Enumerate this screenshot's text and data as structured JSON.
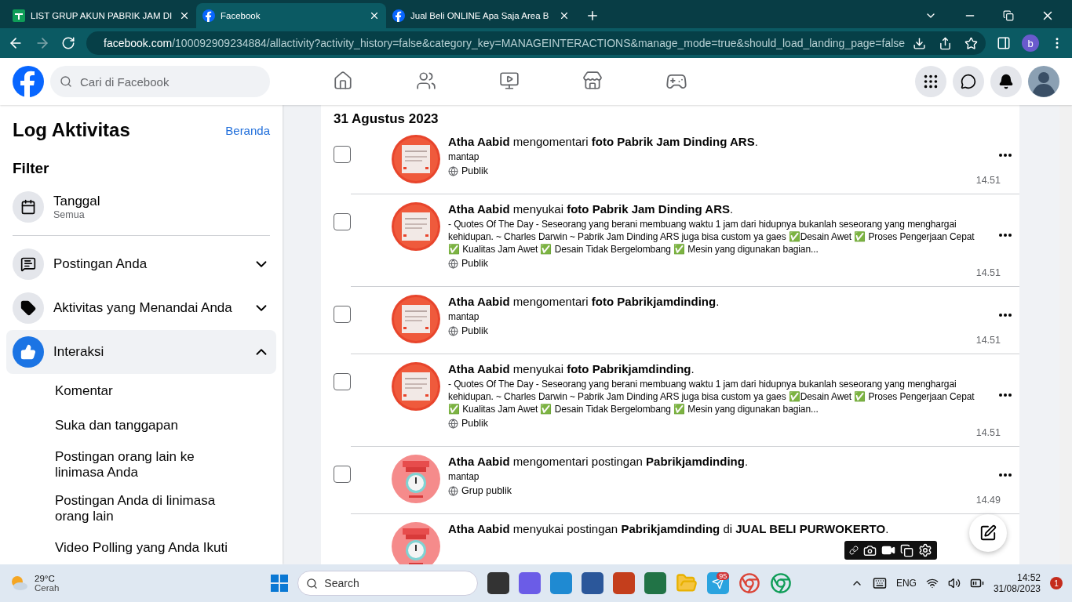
{
  "browser": {
    "tabs": [
      {
        "title": "LIST GRUP AKUN PABRIK JAM DI",
        "kind": "sheets",
        "selected": false
      },
      {
        "title": "Facebook",
        "kind": "facebook",
        "selected": true
      },
      {
        "title": "Jual Beli ONLINE Apa Saja Area B",
        "kind": "facebook",
        "selected": false
      }
    ],
    "url_host": "facebook.com",
    "url_path": "/100092909234884/allactivity?activity_history=false&category_key=MANAGEINTERACTIONS&manage_mode=true&should_load_landing_page=false",
    "profile_initial": "b"
  },
  "header": {
    "search_placeholder": "Cari di Facebook"
  },
  "sidebar": {
    "title": "Log Aktivitas",
    "home_link": "Beranda",
    "filter_heading": "Filter",
    "date_filter": {
      "label": "Tanggal",
      "value": "Semua"
    },
    "categories": [
      {
        "label": "Postingan Anda",
        "kind": "posts",
        "expanded": false,
        "selected": false
      },
      {
        "label": "Aktivitas yang Menandai Anda",
        "kind": "tags",
        "expanded": false,
        "selected": false
      },
      {
        "label": "Interaksi",
        "kind": "likes",
        "expanded": true,
        "selected": true,
        "children": [
          {
            "label": "Komentar"
          },
          {
            "label": "Suka dan tanggapan"
          },
          {
            "label": "Postingan orang lain ke linimasa Anda"
          },
          {
            "label": "Postingan Anda di linimasa orang lain"
          },
          {
            "label": "Video Polling yang Anda Ikuti"
          }
        ]
      }
    ]
  },
  "activity": {
    "date": "31 Agustus 2023",
    "items": [
      {
        "headline": "**Atha Aabid** mengomentari **foto Pabrik Jam Dinding ARS**.",
        "text": "mantap",
        "audience": "Publik",
        "time": "14.51",
        "checked": false,
        "kind": "quote"
      },
      {
        "headline": "**Atha Aabid** menyukai **foto Pabrik Jam Dinding ARS**.",
        "text": "- Quotes Of The Day - Seseorang yang berani membuang waktu 1 jam dari hidupnya bukanlah seseorang yang menghargai kehidupan. ~ Charles Darwin ~ Pabrik Jam Dinding ARS juga bisa custom ya gaes ✅Desain Awet ✅ Proses Pengerjaan Cepat ✅ Kualitas Jam Awet ✅ Desain Tidak Bergelombang ✅ Mesin yang digunakan bagian...",
        "audience": "Publik",
        "time": "14.51",
        "checked": false,
        "kind": "quote"
      },
      {
        "headline": "**Atha Aabid** mengomentari **foto Pabrikjamdinding**.",
        "text": "mantap",
        "audience": "Publik",
        "time": "14.51",
        "checked": false,
        "kind": "quote"
      },
      {
        "headline": "**Atha Aabid** menyukai **foto Pabrikjamdinding**.",
        "text": "- Quotes Of The Day - Seseorang yang berani membuang waktu 1 jam dari hidupnya bukanlah seseorang yang menghargai kehidupan. ~ Charles Darwin ~ Pabrik Jam Dinding ARS juga bisa custom ya gaes ✅Desain Awet ✅ Proses Pengerjaan Cepat ✅ Kualitas Jam Awet ✅ Desain Tidak Bergelombang ✅ Mesin yang digunakan bagian...",
        "audience": "Publik",
        "time": "14.51",
        "checked": false,
        "kind": "quote"
      },
      {
        "headline": "**Atha Aabid** mengomentari postingan **Pabrikjamdinding**.",
        "text": "mantap",
        "audience": "Grup publik",
        "time": "14.49",
        "checked": false,
        "kind": "clock"
      },
      {
        "headline": "**Atha Aabid** menyukai postingan **Pabrikjamdinding** di **JUAL BELI PURWOKERTO**.",
        "kind": "clock"
      }
    ]
  },
  "taskbar": {
    "weather_temp": "29°C",
    "weather_text": "Cerah",
    "search": "Search",
    "telegram_badge": "95",
    "language": "ENG",
    "time": "14:52",
    "date": "31/08/2023",
    "notifications": "1"
  }
}
